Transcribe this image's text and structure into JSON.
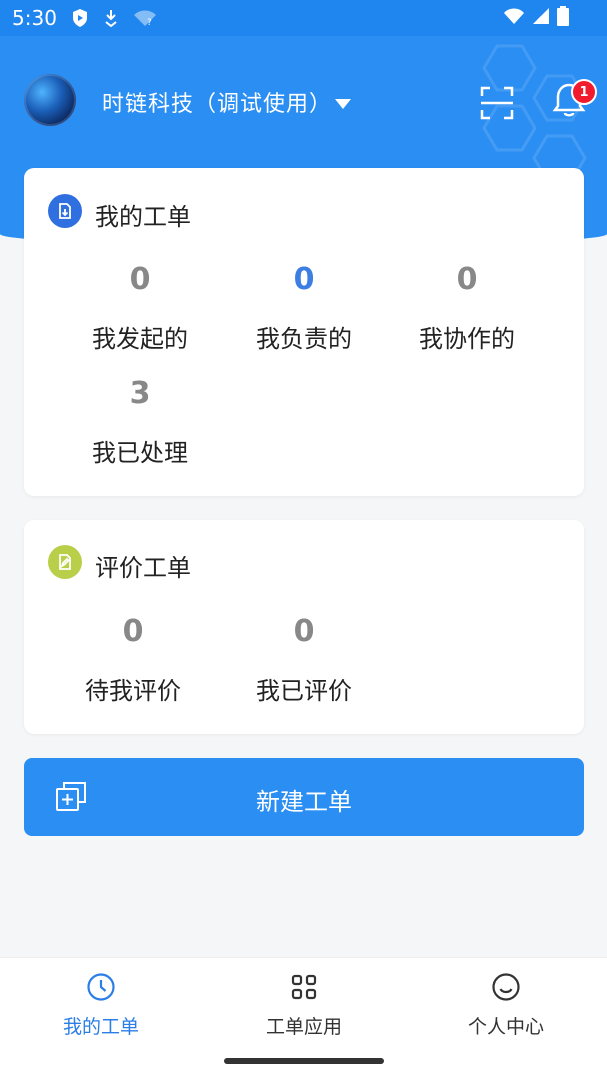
{
  "status_bar": {
    "time": "5:30"
  },
  "header": {
    "org_name": "时链科技（调试使用）",
    "notification_count": "1"
  },
  "my_orders": {
    "title": "我的工单",
    "stats": [
      {
        "value": "0",
        "label": "我发起的"
      },
      {
        "value": "0",
        "label": "我负责的"
      },
      {
        "value": "0",
        "label": "我协作的"
      },
      {
        "value": "3",
        "label": "我已处理"
      }
    ]
  },
  "review_orders": {
    "title": "评价工单",
    "stats": [
      {
        "value": "0",
        "label": "待我评价"
      },
      {
        "value": "0",
        "label": "我已评价"
      }
    ]
  },
  "new_order": {
    "label": "新建工单"
  },
  "bottom_nav": {
    "items": [
      {
        "label": "我的工单",
        "icon": "clock-icon"
      },
      {
        "label": "工单应用",
        "icon": "grid-icon"
      },
      {
        "label": "个人中心",
        "icon": "smile-icon"
      }
    ]
  },
  "colors": {
    "primary": "#2b8ef3",
    "active_stat": "#3d7ee3",
    "my_orders_icon_bg": "#2f6fe0",
    "review_icon_bg": "#b9cf4a",
    "badge": "#f21b2d"
  }
}
